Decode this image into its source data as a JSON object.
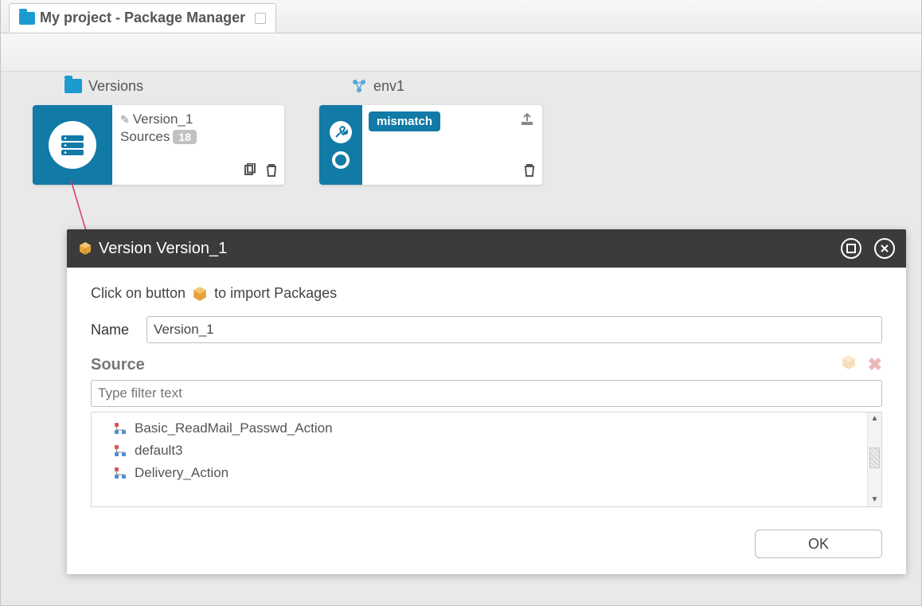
{
  "tab": {
    "title": "My project - Package Manager"
  },
  "columns": {
    "versions": "Versions",
    "env": "env1"
  },
  "version_card": {
    "title": "Version_1",
    "sources_label": "Sources",
    "sources_count": "18"
  },
  "env_card": {
    "badge": "mismatch"
  },
  "panel": {
    "title": "Version Version_1",
    "hint_before": "Click on button",
    "hint_after": "to import Packages",
    "name_label": "Name",
    "name_value": "Version_1",
    "source_label": "Source",
    "filter_placeholder": "Type filter text",
    "items": [
      "Basic_ReadMail_Passwd_Action",
      "default3",
      "Delivery_Action"
    ],
    "ok_label": "OK"
  }
}
